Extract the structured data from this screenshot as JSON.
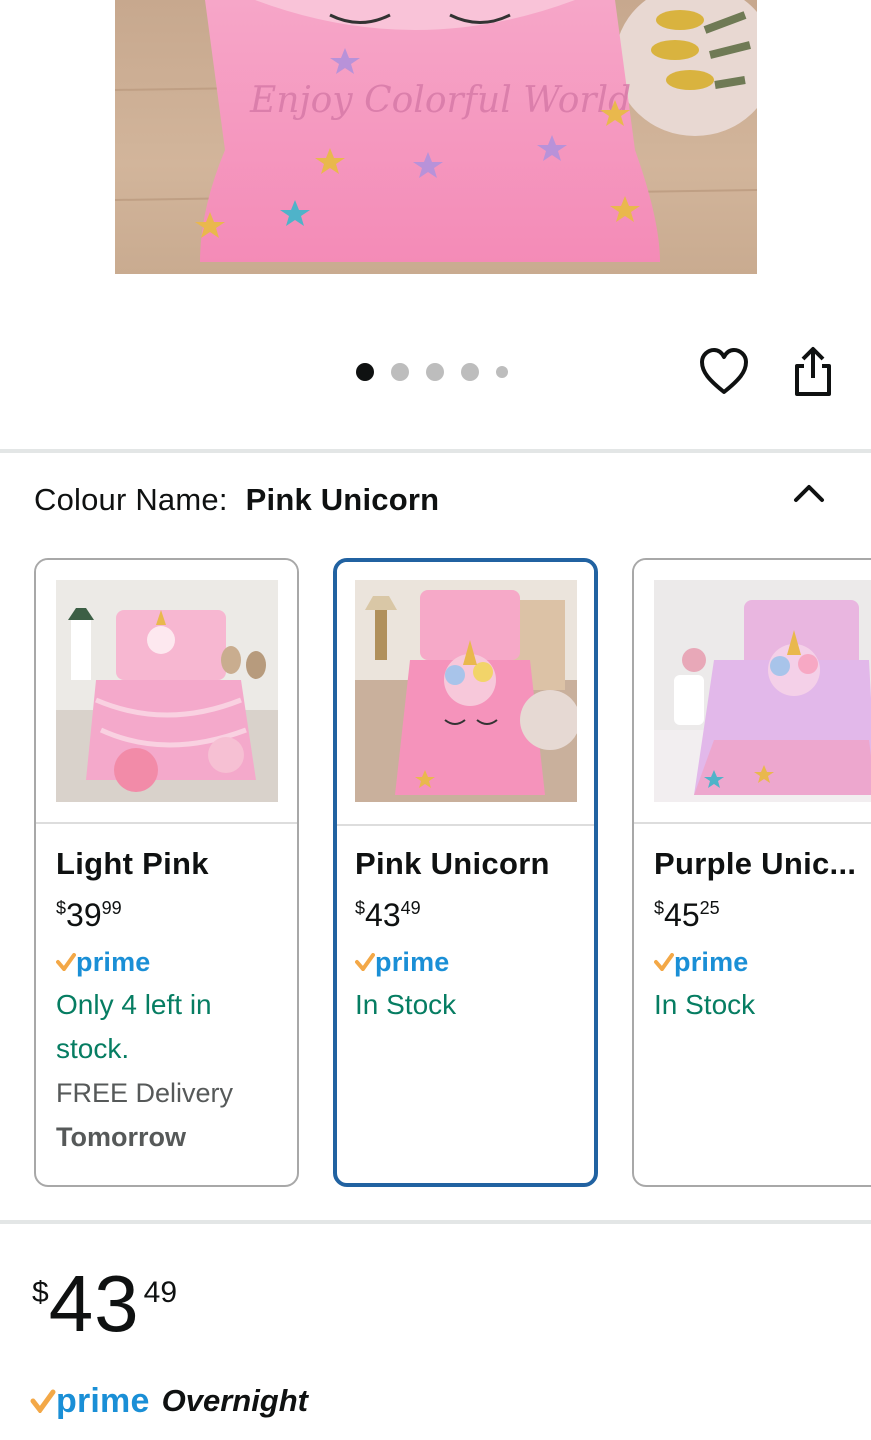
{
  "hero": {
    "image_text": "Enjoy Colorful World",
    "carousel": {
      "total": 5,
      "active": 1
    }
  },
  "actions": {
    "wishlist_icon": "heart-icon",
    "share_icon": "share-icon"
  },
  "colour": {
    "label": "Colour Name:",
    "selected": "Pink Unicorn",
    "collapse_icon": "chevron-up-icon"
  },
  "swatches": [
    {
      "name": "Light Pink",
      "price_symbol": "$",
      "price_whole": "39",
      "price_fraction": "99",
      "prime": "prime",
      "stock": "Only 4 left in stock.",
      "delivery": "FREE Delivery",
      "delivery_day": "Tomorrow",
      "selected": false
    },
    {
      "name": "Pink Unicorn",
      "price_symbol": "$",
      "price_whole": "43",
      "price_fraction": "49",
      "prime": "prime",
      "stock": "In Stock",
      "selected": true
    },
    {
      "name": "Purple Unic...",
      "price_symbol": "$",
      "price_whole": "45",
      "price_fraction": "25",
      "prime": "prime",
      "stock": "In Stock",
      "selected": false
    }
  ],
  "price": {
    "symbol": "$",
    "whole": "43",
    "fraction": "49"
  },
  "shipping": {
    "prime": "prime",
    "speed": "Overnight"
  },
  "colors": {
    "prime_blue": "#1a8fd6",
    "prime_check": "#f3a847",
    "stock_green": "#067d62",
    "selected_border": "#2162a1"
  }
}
